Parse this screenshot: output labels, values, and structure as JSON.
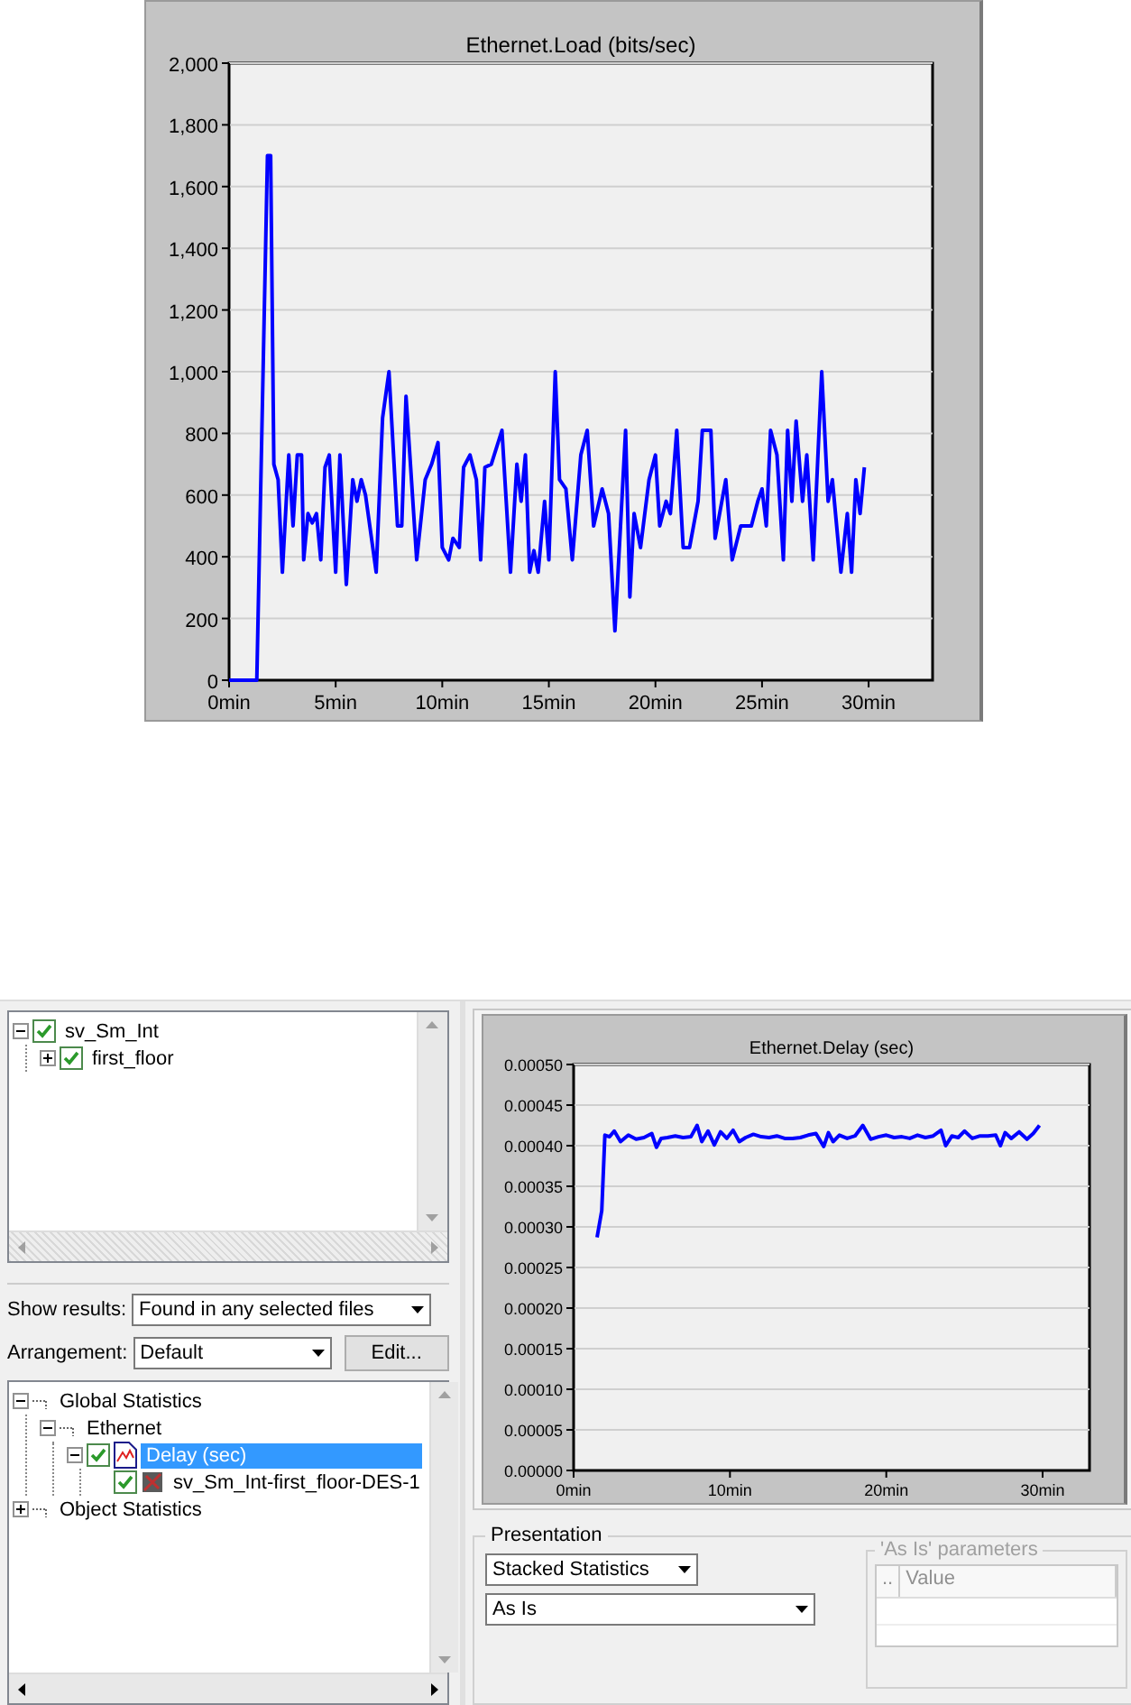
{
  "top_chart": {
    "chart_data": {
      "type": "line",
      "title": "Ethernet.Load (bits/sec)",
      "x": [
        0,
        1.3,
        1.8,
        1.95,
        2.1,
        2.3,
        2.5,
        2.8,
        3.0,
        3.2,
        3.4,
        3.5,
        3.7,
        3.9,
        4.1,
        4.3,
        4.5,
        4.7,
        5.0,
        5.2,
        5.5,
        5.8,
        6.0,
        6.2,
        6.4,
        6.9,
        7.2,
        7.5,
        7.9,
        8.1,
        8.3,
        8.8,
        9.2,
        9.5,
        9.8,
        10.0,
        10.3,
        10.5,
        10.8,
        11.0,
        11.3,
        11.6,
        11.8,
        12.0,
        12.3,
        12.8,
        13.2,
        13.5,
        13.7,
        13.9,
        14.1,
        14.3,
        14.5,
        14.8,
        15.0,
        15.3,
        15.5,
        15.8,
        16.1,
        16.5,
        16.8,
        17.1,
        17.5,
        17.8,
        18.1,
        18.6,
        18.8,
        19.0,
        19.3,
        19.7,
        20.0,
        20.2,
        20.5,
        20.7,
        21.0,
        21.3,
        21.6,
        22.0,
        22.2,
        22.6,
        22.8,
        23.3,
        23.6,
        24.0,
        24.5,
        24.8,
        25.0,
        25.2,
        25.4,
        25.7,
        26.0,
        26.2,
        26.4,
        26.6,
        26.9,
        27.1,
        27.4,
        27.8,
        28.1,
        28.3,
        28.7,
        29.0,
        29.2,
        29.4,
        29.6,
        29.8
      ],
      "grid": true,
      "series": [
        {
          "color": "#0000ff",
          "values": [
            0,
            0,
            1700,
            1700,
            700,
            650,
            350,
            730,
            500,
            730,
            730,
            390,
            540,
            510,
            540,
            390,
            690,
            730,
            350,
            730,
            310,
            650,
            580,
            650,
            600,
            350,
            850,
            1000,
            500,
            500,
            920,
            390,
            650,
            700,
            770,
            430,
            390,
            460,
            430,
            690,
            730,
            650,
            390,
            690,
            700,
            810,
            350,
            700,
            580,
            730,
            350,
            420,
            350,
            580,
            390,
            1000,
            650,
            620,
            390,
            730,
            810,
            500,
            620,
            540,
            160,
            810,
            270,
            540,
            430,
            650,
            730,
            500,
            580,
            540,
            810,
            430,
            430,
            580,
            810,
            810,
            460,
            650,
            390,
            500,
            500,
            580,
            620,
            500,
            810,
            730,
            390,
            810,
            580,
            840,
            580,
            730,
            390,
            1000,
            580,
            650,
            350,
            540,
            350,
            650,
            540,
            690
          ]
        }
      ],
      "xlim": [
        0,
        33
      ],
      "ylim": [
        0,
        2000
      ],
      "xticks": [
        {
          "value": 0,
          "label": "0min"
        },
        {
          "value": 5,
          "label": "5min"
        },
        {
          "value": 10,
          "label": "10min"
        },
        {
          "value": 15,
          "label": "15min"
        },
        {
          "value": 20,
          "label": "20min"
        },
        {
          "value": 25,
          "label": "25min"
        },
        {
          "value": 30,
          "label": "30min"
        }
      ],
      "yticks": [
        {
          "value": 0,
          "label": "0"
        },
        {
          "value": 200,
          "label": "200"
        },
        {
          "value": 400,
          "label": "400"
        },
        {
          "value": 600,
          "label": "600"
        },
        {
          "value": 800,
          "label": "800"
        },
        {
          "value": 1000,
          "label": "1,000"
        },
        {
          "value": 1200,
          "label": "1,200"
        },
        {
          "value": 1400,
          "label": "1,400"
        },
        {
          "value": 1600,
          "label": "1,600"
        },
        {
          "value": 1800,
          "label": "1,800"
        },
        {
          "value": 2000,
          "label": "2,000"
        }
      ]
    }
  },
  "results_panel": {
    "scenario_tree": [
      {
        "label": "sv_Sm_Int",
        "kind": "scenario",
        "expanded": true,
        "checked": true,
        "children": [
          {
            "label": "first_floor",
            "kind": "scenario",
            "expanded": false,
            "checked": true
          }
        ]
      }
    ],
    "show_results": {
      "label": "Show results:",
      "value": "Found in any selected files"
    },
    "arrangement": {
      "label": "Arrangement:",
      "value": "Default"
    },
    "edit_button": "Edit...",
    "statistics_tree": [
      {
        "label": "Global Statistics",
        "kind": "group",
        "expanded": true,
        "selected": false,
        "children": [
          {
            "label": "Ethernet",
            "kind": "group",
            "expanded": true,
            "selected": false,
            "children": [
              {
                "label": "Delay (sec)",
                "kind": "stat",
                "expanded": true,
                "checked": true,
                "selected": true,
                "children": [
                  {
                    "label": "sv_Sm_Int-first_floor-DES-1",
                    "kind": "object",
                    "checked": true,
                    "selected": false
                  }
                ]
              }
            ]
          }
        ]
      },
      {
        "label": "Object Statistics",
        "kind": "group",
        "expanded": false,
        "selected": false
      }
    ]
  },
  "delay_chart": {
    "chart_data": {
      "type": "line",
      "title": "Ethernet.Delay (sec)",
      "x": [
        1.5,
        1.8,
        2.0,
        2.3,
        2.6,
        3.0,
        3.5,
        4.0,
        4.5,
        5.0,
        5.3,
        5.6,
        6.0,
        6.5,
        7.0,
        7.5,
        7.9,
        8.2,
        8.6,
        9.0,
        9.4,
        9.8,
        10.2,
        10.6,
        11.0,
        11.5,
        12.0,
        12.5,
        13.0,
        13.5,
        14.0,
        14.5,
        15.0,
        15.5,
        16.0,
        16.3,
        16.6,
        17.0,
        17.5,
        18.0,
        18.5,
        19.0,
        19.5,
        20.0,
        20.5,
        21.0,
        21.5,
        22.0,
        22.5,
        23.0,
        23.5,
        23.8,
        24.2,
        24.6,
        25.0,
        25.5,
        26.0,
        26.5,
        27.0,
        27.3,
        27.6,
        28.0,
        28.5,
        29.0,
        29.4,
        29.8
      ],
      "grid": true,
      "series": [
        {
          "color": "#0000ff",
          "values": [
            0.000287,
            0.00032,
            0.000413,
            0.000411,
            0.000418,
            0.000405,
            0.000413,
            0.000408,
            0.00041,
            0.000415,
            0.000398,
            0.000409,
            0.00041,
            0.000412,
            0.00041,
            0.000411,
            0.000425,
            0.000405,
            0.000418,
            0.000401,
            0.000417,
            0.000409,
            0.000419,
            0.000405,
            0.00041,
            0.000414,
            0.000411,
            0.00041,
            0.000412,
            0.000409,
            0.000409,
            0.00041,
            0.000413,
            0.000415,
            0.000399,
            0.000416,
            0.000405,
            0.000413,
            0.000409,
            0.000412,
            0.000425,
            0.000408,
            0.000411,
            0.000413,
            0.00041,
            0.000411,
            0.000409,
            0.000413,
            0.00041,
            0.000412,
            0.000419,
            0.0004,
            0.000412,
            0.00041,
            0.000418,
            0.000409,
            0.000412,
            0.000412,
            0.000413,
            0.0004,
            0.000416,
            0.000409,
            0.000417,
            0.000408,
            0.000415,
            0.000425
          ]
        }
      ],
      "xlim": [
        0,
        33
      ],
      "ylim": [
        0,
        0.0005
      ],
      "xticks": [
        {
          "value": 0,
          "label": "0min"
        },
        {
          "value": 10,
          "label": "10min"
        },
        {
          "value": 20,
          "label": "20min"
        },
        {
          "value": 30,
          "label": "30min"
        }
      ],
      "yticks": [
        {
          "value": 0,
          "label": "0.00000"
        },
        {
          "value": 5e-05,
          "label": "0.00005"
        },
        {
          "value": 0.0001,
          "label": "0.00010"
        },
        {
          "value": 0.00015,
          "label": "0.00015"
        },
        {
          "value": 0.0002,
          "label": "0.00020"
        },
        {
          "value": 0.00025,
          "label": "0.00025"
        },
        {
          "value": 0.0003,
          "label": "0.00030"
        },
        {
          "value": 0.00035,
          "label": "0.00035"
        },
        {
          "value": 0.0004,
          "label": "0.00040"
        },
        {
          "value": 0.00045,
          "label": "0.00045"
        },
        {
          "value": 0.0005,
          "label": "0.00050"
        }
      ]
    }
  },
  "presentation": {
    "title": "Presentation",
    "mode": "Stacked Statistics",
    "filter": "As Is",
    "parameters": {
      "title": "'As Is' parameters",
      "disabled": true,
      "columns": [
        "..",
        "Value"
      ]
    }
  }
}
